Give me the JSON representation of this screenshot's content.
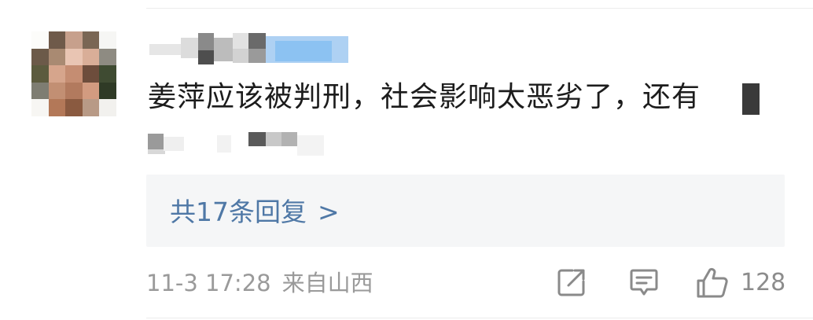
{
  "comment": {
    "text": "姜萍应该被判刑，社会影响太恶劣了，还有",
    "replies_label": "共17条回复",
    "replies_chevron": ">",
    "date": "11-3 17:28",
    "location": "来自山西",
    "like_count": "128"
  },
  "icons": {
    "share": "share-icon",
    "reply": "comment-icon",
    "like": "thumbs-up-icon"
  },
  "colors": {
    "link": "#4f78a6",
    "meta": "#9a9a9a",
    "reply_box_bg": "#f5f6f7"
  }
}
